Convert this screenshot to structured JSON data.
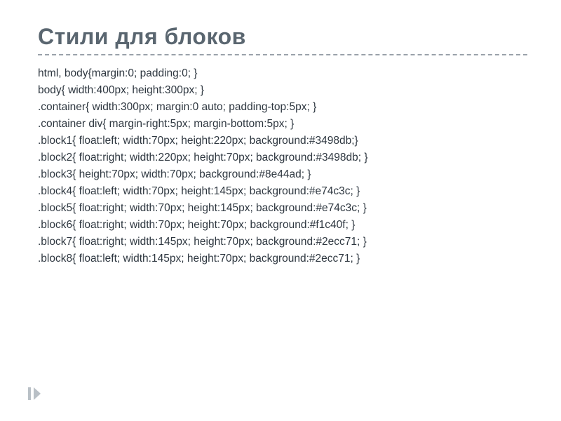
{
  "title": "Стили для блоков",
  "code": {
    "l1": "html, body{margin:0; padding:0; }",
    "l2": "body{ width:400px; height:300px; }",
    "l3": ".container{ width:300px; margin:0 auto; padding-top:5px; }",
    "l4": ".container div{ margin-right:5px; margin-bottom:5px; }",
    "l5": ".block1{ float:left; width:70px; height:220px; background:#3498db;}",
    "l6": ".block2{ float:right; width:220px; height:70px; background:#3498db; }",
    "l7": ".block3{ height:70px; width:70px; background:#8e44ad; }",
    "l8": ".block4{ float:left; width:70px; height:145px; background:#e74c3c; }",
    "l9": ".block5{ float:right; width:70px; height:145px; background:#e74c3c; }",
    "l10": ".block6{ float:right; width:70px; height:70px; background:#f1c40f; }",
    "l11": ".block7{ float:right; width:145px; height:70px; background:#2ecc71; }",
    "l12": ".block8{ float:left; width:145px; height:70px; background:#2ecc71; }"
  }
}
